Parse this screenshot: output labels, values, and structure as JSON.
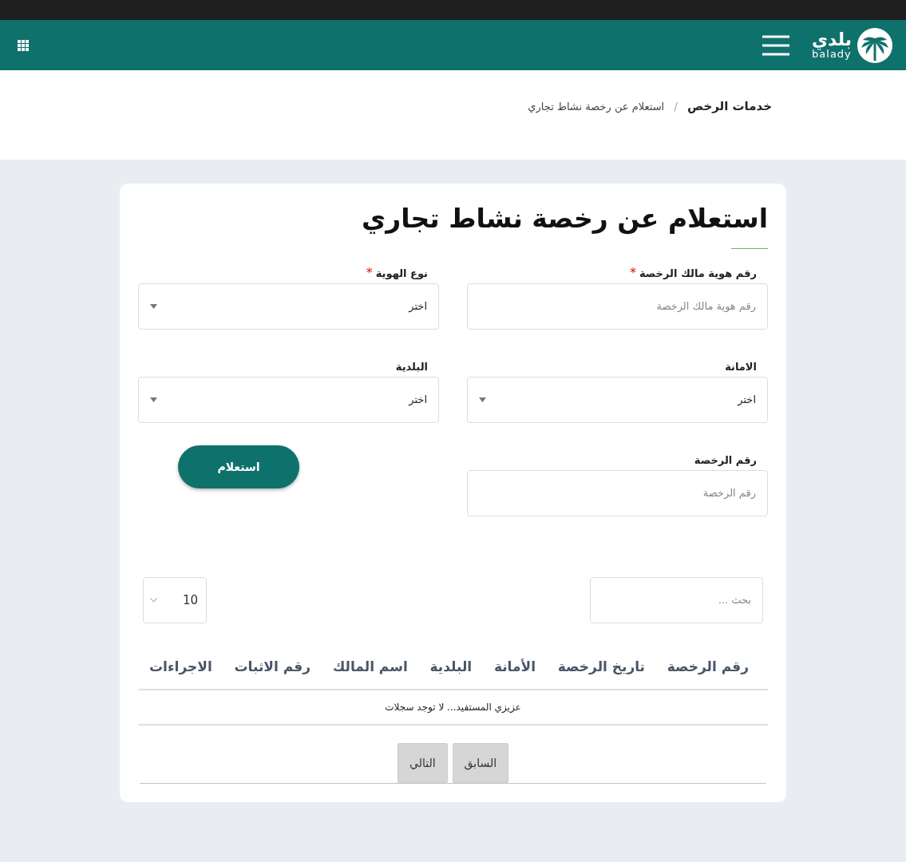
{
  "header": {
    "logo_arabic": "بلدي",
    "logo_latin": "balady"
  },
  "breadcrumb": [
    {
      "label": "خدمات الرخص",
      "current": false
    },
    {
      "label": "استعلام عن رخصة نشاط تجاري",
      "current": true
    }
  ],
  "breadcrumb_separator": "/",
  "required_marker": "*",
  "page_title": "استعلام عن رخصة نشاط تجاري",
  "fields": [
    {
      "kind": "text",
      "label": "رقم هوية مالك الرخصة",
      "required": true,
      "placeholder": "رقم هوية مالك الرخصة"
    },
    {
      "kind": "select",
      "label": "نوع الهوية",
      "required": true,
      "value": "اختر"
    },
    {
      "kind": "select",
      "label": "الامانة",
      "required": false,
      "value": "اختر"
    },
    {
      "kind": "select",
      "label": "البلدية",
      "required": false,
      "value": "اختر"
    },
    {
      "kind": "text",
      "label": "رقم الرخصة",
      "required": false,
      "placeholder": "رقم الرخصة"
    }
  ],
  "submit_button": "استعلام",
  "table": {
    "search": {
      "placeholder": "بحث ..."
    },
    "page_size": "10",
    "columns": [
      "رقم الرخصة",
      "تاريخ الرخصة",
      "الأمانة",
      "البلدية",
      "اسم المالك",
      "رقم الاثبات",
      "الاجراءات"
    ],
    "empty_message": "عزيزي المستفيد... لا توجد سجلات"
  },
  "pagination": [
    "السابق",
    "التالي"
  ]
}
